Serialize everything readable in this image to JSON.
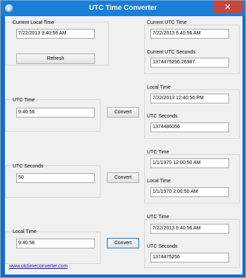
{
  "window": {
    "title": "UTC Time Converter",
    "close_label": "✕",
    "website_link": "www.utctimeconverter.com"
  },
  "local_time_panel": {
    "label": "Current Local Time",
    "value": "7/22/2013 9:40:56 AM",
    "refresh_label": "Refresh"
  },
  "current_utc": {
    "time_label": "Current UTC Time",
    "time_value": "7/22/2013 6:40:56 AM",
    "seconds_label": "Current UTC Seconds",
    "seconds_value": "1374475256.26987"
  },
  "utc_time_panel": {
    "label": "UTC Time",
    "value": "9:40:56",
    "convert_label": "Convert"
  },
  "utc_time_results": {
    "local_time_label": "Local Time",
    "local_time_value": "7/22/2013 12:40:56 PM",
    "utc_seconds_label": "UTC Seconds",
    "utc_seconds_value": "1374486056"
  },
  "utc_seconds_panel": {
    "label": "UTC Seconds",
    "value": "50",
    "convert_label": "Convert"
  },
  "utc_seconds_results": {
    "utc_time_label": "UTC Time",
    "utc_time_value": "1/1/1970 12:00:50 AM",
    "local_time_label": "Local Time",
    "local_time_value": "1/1/1970 2:00:50 AM"
  },
  "local_time_panel2": {
    "label": "Local Time",
    "value": "9:40:56",
    "convert_label": "Convert"
  },
  "local_time_results": {
    "utc_time_label": "UTC Time",
    "utc_time_value": "7/22/2013 6:40:56 AM",
    "utc_seconds_label": "UTC Seconds",
    "utc_seconds_value": "1374475256"
  },
  "colors": {
    "titlebar": "#1a7fd6",
    "close_button": "#c7463b",
    "window_bg": "#f0f0f0"
  }
}
